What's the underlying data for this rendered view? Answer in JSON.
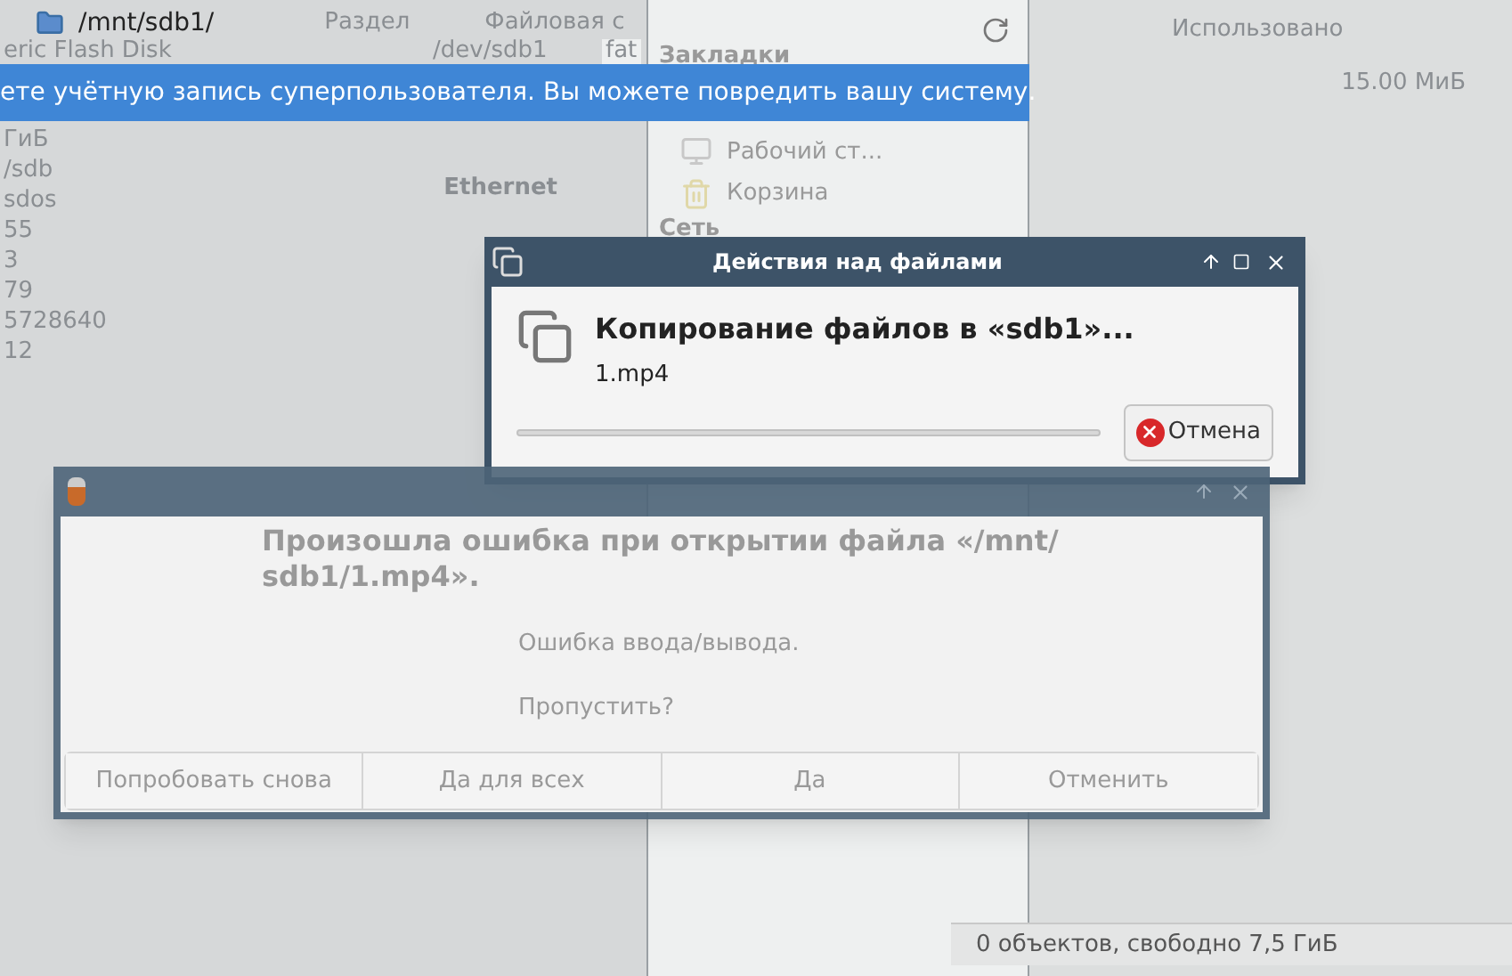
{
  "background": {
    "path": "/mnt/sdb1/",
    "columns": [
      "Раздел",
      "Файловая с",
      "Использовано"
    ],
    "row": {
      "device": "/dev/sdb1",
      "fs": "fat",
      "used": "15.00 МиБ"
    },
    "left_values": [
      "eric Flash Disk",
      "ГиБ",
      "/sdb",
      "sdos",
      "55",
      "3",
      "79",
      "5728640",
      "12"
    ],
    "network_items": [
      "Ethernet"
    ],
    "sidebar": {
      "bookmarks_title": "Закладки",
      "items": [
        "Рабочий ст...",
        "Корзина"
      ],
      "network_title": "Сеть"
    },
    "status_bar": "0 объектов, свободно 7,5 ГиБ"
  },
  "banner": "ете учётную запись суперпользователя. Вы можете повредить вашу систему.",
  "copy_dialog": {
    "title": "Действия над файлами",
    "heading": "Копирование файлов в «sdb1»...",
    "file": "1.mp4",
    "progress": {
      "level": 0
    },
    "cancel": "Отмена"
  },
  "error_dialog": {
    "heading": "Произошла ошибка при открытии файла «/mnt/ sdb1/1.mp4».",
    "message": "Ошибка ввода/вывода.",
    "question": "Пропустить?",
    "buttons": [
      "Попробовать снова",
      "Да для всех",
      "Да",
      "Отменить"
    ]
  }
}
